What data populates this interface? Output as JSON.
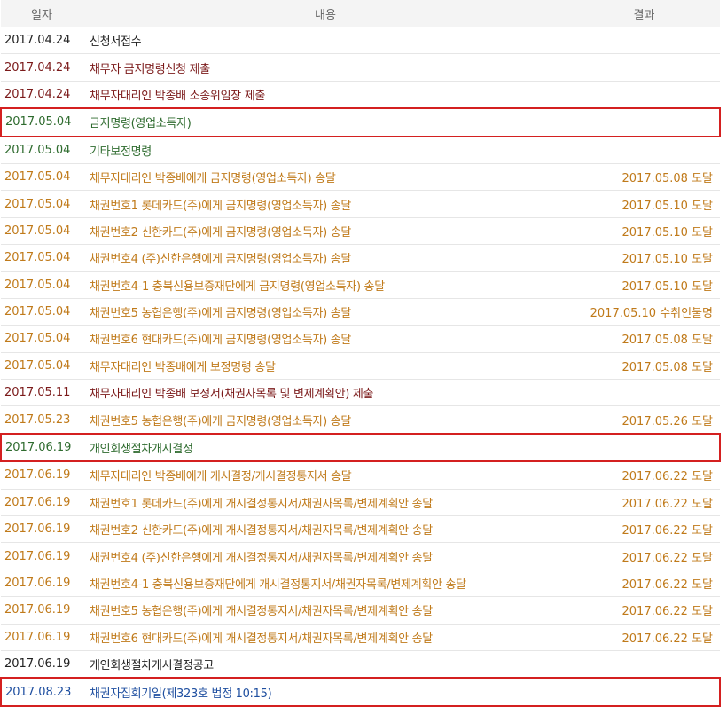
{
  "table": {
    "headers": {
      "date": "일자",
      "content": "내용",
      "result": "결과"
    },
    "rows": [
      {
        "date": "2017.04.24",
        "content": "신청서접수",
        "result": "",
        "color": "#222222",
        "highlight": false
      },
      {
        "date": "2017.04.24",
        "content": "채무자 금지명령신청 제출",
        "result": "",
        "color": "#7b1a1a",
        "highlight": false
      },
      {
        "date": "2017.04.24",
        "content": "채무자대리인 박종배 소송위임장 제출",
        "result": "",
        "color": "#7b1a1a",
        "highlight": false
      },
      {
        "date": "2017.05.04",
        "content": "금지명령(영업소득자)",
        "result": "",
        "color": "#2e6b2e",
        "highlight": true
      },
      {
        "date": "2017.05.04",
        "content": "기타보정명령",
        "result": "",
        "color": "#2e6b2e",
        "highlight": false
      },
      {
        "date": "2017.05.04",
        "content": "채무자대리인 박종배에게 금지명령(영업소득자) 송달",
        "result": "2017.05.08 도달",
        "color": "#c07a1a",
        "highlight": false
      },
      {
        "date": "2017.05.04",
        "content": "채권번호1 롯데카드(주)에게 금지명령(영업소득자) 송달",
        "result": "2017.05.10 도달",
        "color": "#c07a1a",
        "highlight": false
      },
      {
        "date": "2017.05.04",
        "content": "채권번호2 신한카드(주)에게 금지명령(영업소득자) 송달",
        "result": "2017.05.10 도달",
        "color": "#c07a1a",
        "highlight": false
      },
      {
        "date": "2017.05.04",
        "content": "채권번호4 (주)신한은행에게 금지명령(영업소득자) 송달",
        "result": "2017.05.10 도달",
        "color": "#c07a1a",
        "highlight": false
      },
      {
        "date": "2017.05.04",
        "content": "채권번호4-1 충북신용보증재단에게 금지명령(영업소득자) 송달",
        "result": "2017.05.10 도달",
        "color": "#c07a1a",
        "highlight": false
      },
      {
        "date": "2017.05.04",
        "content": "채권번호5 농협은행(주)에게 금지명령(영업소득자) 송달",
        "result": "2017.05.10 수취인불명",
        "color": "#c07a1a",
        "highlight": false
      },
      {
        "date": "2017.05.04",
        "content": "채권번호6 현대카드(주)에게 금지명령(영업소득자) 송달",
        "result": "2017.05.08 도달",
        "color": "#c07a1a",
        "highlight": false
      },
      {
        "date": "2017.05.04",
        "content": "채무자대리인 박종배에게 보정명령 송달",
        "result": "2017.05.08 도달",
        "color": "#c07a1a",
        "highlight": false
      },
      {
        "date": "2017.05.11",
        "content": "채무자대리인 박종배 보정서(채권자목록 및 변제계획안) 제출",
        "result": "",
        "color": "#7b1a1a",
        "highlight": false
      },
      {
        "date": "2017.05.23",
        "content": "채권번호5 농협은행(주)에게 금지명령(영업소득자) 송달",
        "result": "2017.05.26 도달",
        "color": "#c07a1a",
        "highlight": false
      },
      {
        "date": "2017.06.19",
        "content": "개인회생절차개시결정",
        "result": "",
        "color": "#2e6b2e",
        "highlight": true
      },
      {
        "date": "2017.06.19",
        "content": "채무자대리인 박종배에게 개시결정/개시결정통지서 송달",
        "result": "2017.06.22 도달",
        "color": "#c07a1a",
        "highlight": false
      },
      {
        "date": "2017.06.19",
        "content": "채권번호1 롯데카드(주)에게 개시결정통지서/채권자목록/변제계획안 송달",
        "result": "2017.06.22 도달",
        "color": "#c07a1a",
        "highlight": false
      },
      {
        "date": "2017.06.19",
        "content": "채권번호2 신한카드(주)에게 개시결정통지서/채권자목록/변제계획안 송달",
        "result": "2017.06.22 도달",
        "color": "#c07a1a",
        "highlight": false
      },
      {
        "date": "2017.06.19",
        "content": "채권번호4 (주)신한은행에게 개시결정통지서/채권자목록/변제계획안 송달",
        "result": "2017.06.22 도달",
        "color": "#c07a1a",
        "highlight": false
      },
      {
        "date": "2017.06.19",
        "content": "채권번호4-1 충북신용보증재단에게 개시결정통지서/채권자목록/변제계획안 송달",
        "result": "2017.06.22 도달",
        "color": "#c07a1a",
        "highlight": false
      },
      {
        "date": "2017.06.19",
        "content": "채권번호5 농협은행(주)에게 개시결정통지서/채권자목록/변제계획안 송달",
        "result": "2017.06.22 도달",
        "color": "#c07a1a",
        "highlight": false
      },
      {
        "date": "2017.06.19",
        "content": "채권번호6 현대카드(주)에게 개시결정통지서/채권자목록/변제계획안 송달",
        "result": "2017.06.22 도달",
        "color": "#c07a1a",
        "highlight": false
      },
      {
        "date": "2017.06.19",
        "content": "개인회생절차개시결정공고",
        "result": "",
        "color": "#222222",
        "highlight": false
      },
      {
        "date": "2017.08.23",
        "content": "채권자집회기일(제323호 법정 10:15)",
        "result": "",
        "color": "#1f4fa0",
        "highlight": true
      }
    ]
  }
}
